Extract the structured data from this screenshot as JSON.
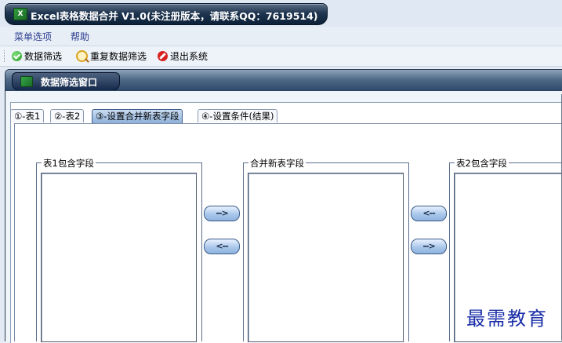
{
  "window": {
    "title": "Excel表格数据合并 V1.0(未注册版本，请联系QQ：7619514)",
    "icon": "excel-app-icon"
  },
  "menubar": {
    "items": [
      "菜单选项",
      "帮助"
    ]
  },
  "toolbar": {
    "buttons": [
      {
        "label": "数据筛选",
        "icon": "check-circle-icon"
      },
      {
        "label": "重复数据筛选",
        "icon": "search-icon"
      },
      {
        "label": "退出系统",
        "icon": "stop-icon"
      }
    ]
  },
  "child_window": {
    "title": "数据筛选窗口",
    "icon": "excel-app-icon"
  },
  "tabs": [
    {
      "label": "①-表1",
      "active": false
    },
    {
      "label": "②-表2",
      "active": false
    },
    {
      "label": "③-设置合并新表字段",
      "active": true
    },
    {
      "label": "④-设置条件(结果)",
      "active": false
    }
  ],
  "groups": {
    "table1_fields": "表1包含字段",
    "merged_fields": "合并新表字段",
    "table2_fields": "表2包含字段"
  },
  "buttons": {
    "left_add": "-->",
    "left_remove": "<--",
    "right_add": "<--",
    "right_remove": "-->"
  },
  "watermark": "最需教育",
  "colors": {
    "title_bar": "#1f3550",
    "menu_text": "#2a3d8f",
    "active_tab": "#8fb0d8",
    "watermark": "#1a2ea8"
  }
}
